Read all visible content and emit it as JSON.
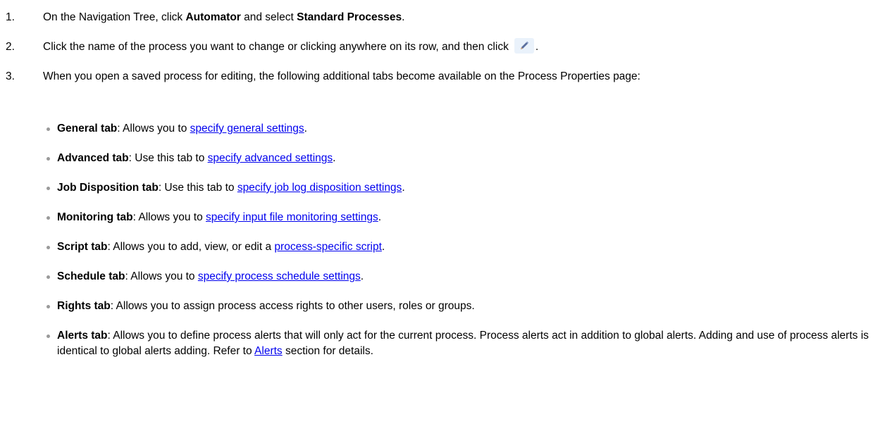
{
  "steps": [
    {
      "number": "1.",
      "before": "On the Navigation Tree, click ",
      "bold1": "Automator",
      "middle": " and select ",
      "bold2": "Standard Processes",
      "after": "."
    },
    {
      "number": "2.",
      "text": "Click the name of the process you want to change or clicking anywhere on its row, and then click",
      "icon": "edit-pencil-icon",
      "after": "."
    },
    {
      "number": "3.",
      "text": "When you open a saved process for editing, the following additional tabs become available on the Process Properties page:"
    }
  ],
  "bullets": [
    {
      "title": "General tab",
      "text": ": Allows you to ",
      "link": "specify general settings",
      "after": "."
    },
    {
      "title": "Advanced tab",
      "text": ": Use this tab to ",
      "link": "specify advanced settings",
      "after": "."
    },
    {
      "title": "Job Disposition tab",
      "text": ": Use this tab to ",
      "link": "specify job log disposition settings",
      "after": "."
    },
    {
      "title": "Monitoring tab",
      "text": ": Allows you to ",
      "link": "specify input file monitoring settings",
      "after": "."
    },
    {
      "title": "Script tab",
      "text": ": Allows you to add, view, or edit a ",
      "link": "process-specific script",
      "after": "."
    },
    {
      "title": "Schedule tab",
      "text": ": Allows you to ",
      "link": "specify process schedule settings",
      "after": "."
    },
    {
      "title": "Rights tab",
      "text": ": Allows you to assign process access rights to other users, roles or groups."
    },
    {
      "title": "Alerts tab",
      "text": ": Allows you to define process alerts that will only act for the current process. Process alerts act in addition to global alerts. Adding and use of process alerts is identical to global alerts adding. Refer to ",
      "link": "Alerts",
      "after": " section for details."
    }
  ],
  "colors": {
    "link": "#0000ee",
    "bullet": "#9a9a9a",
    "icon_background": "#eaf2fb",
    "icon_pencil": "#5b6f9e"
  }
}
